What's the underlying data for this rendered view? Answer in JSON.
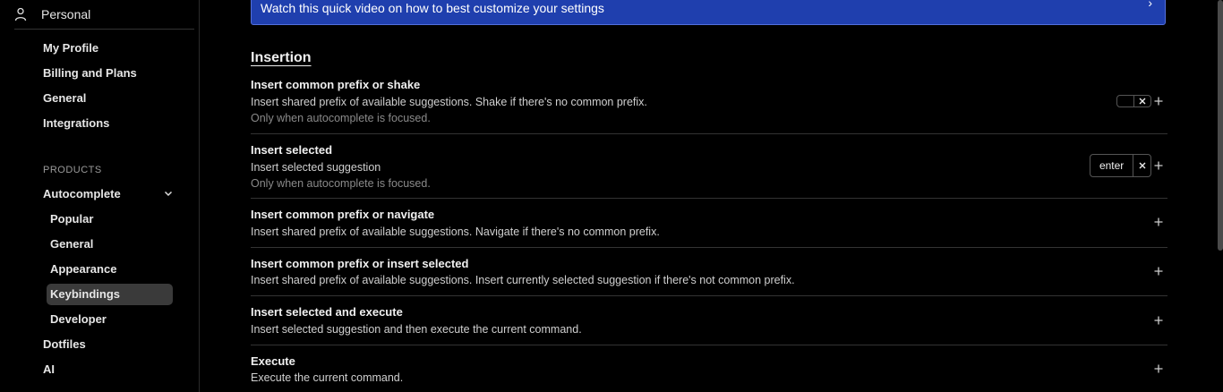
{
  "sidebar": {
    "account_label": "Personal",
    "account_items": [
      "My Profile",
      "Billing and Plans",
      "General",
      "Integrations"
    ],
    "products_label": "PRODUCTS",
    "autocomplete_label": "Autocomplete",
    "autocomplete_items": [
      "Popular",
      "General",
      "Appearance",
      "Keybindings",
      "Developer"
    ],
    "active_item": "Keybindings",
    "more_items": [
      "Dotfiles",
      "AI"
    ]
  },
  "banner": {
    "text": "Watch this quick video on how to best customize your settings"
  },
  "section_title": "Insertion",
  "rows": [
    {
      "title": "Insert common prefix or shake",
      "description": "Insert shared prefix of available suggestions. Shake if there's no common prefix.",
      "note": "Only when autocomplete is focused.",
      "key": ""
    },
    {
      "title": "Insert selected",
      "description": "Insert selected suggestion",
      "note": "Only when autocomplete is focused.",
      "key": "enter"
    },
    {
      "title": "Insert common prefix or navigate",
      "description": "Insert shared prefix of available suggestions. Navigate if there's no common prefix."
    },
    {
      "title": "Insert common prefix or insert selected",
      "description": "Insert shared prefix of available suggestions. Insert currently selected suggestion if there's not common prefix."
    },
    {
      "title": "Insert selected and execute",
      "description": "Insert selected suggestion and then execute the current command."
    },
    {
      "title": "Execute",
      "description": "Execute the current command."
    }
  ]
}
